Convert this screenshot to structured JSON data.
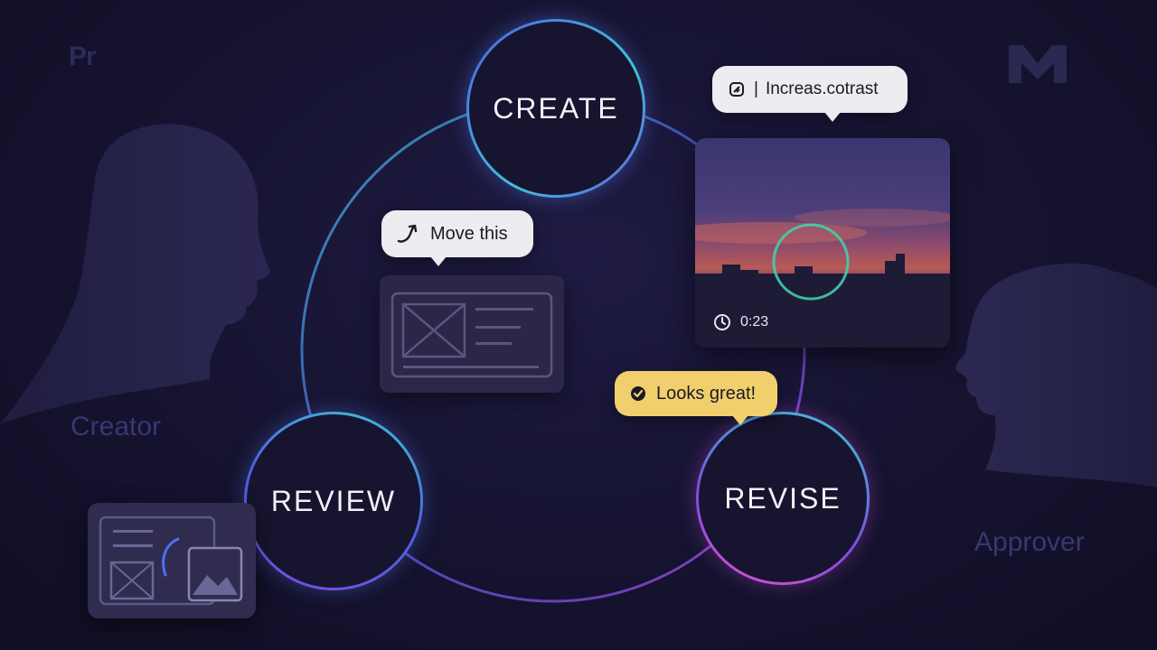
{
  "logos": {
    "left_logo_text": "Pr",
    "right_logo_icon": "m-logo-icon"
  },
  "people": {
    "creator_label": "Creator",
    "approver_label": "Approver"
  },
  "cycle": {
    "stages": [
      {
        "label": "CREATE"
      },
      {
        "label": "REVIEW"
      },
      {
        "label": "REVISE"
      }
    ]
  },
  "comments": {
    "contrast": {
      "icon": "tag-icon",
      "text": "Increas.cotrast"
    },
    "move": {
      "icon": "curved-arrow-icon",
      "text": "Move this"
    },
    "approval": {
      "icon": "check-circle-icon",
      "text": "Looks great!"
    }
  },
  "video_preview": {
    "timecode": "0:23",
    "timecode_icon": "clock-icon"
  },
  "colors": {
    "background": "#15132f",
    "ring_gradient_start": "#4f5fe0",
    "ring_gradient_mid": "#3fc3d6",
    "ring_gradient_end": "#d24fd8",
    "approval_bubble": "#f2cf6d",
    "comment_bubble": "#ececf1"
  }
}
